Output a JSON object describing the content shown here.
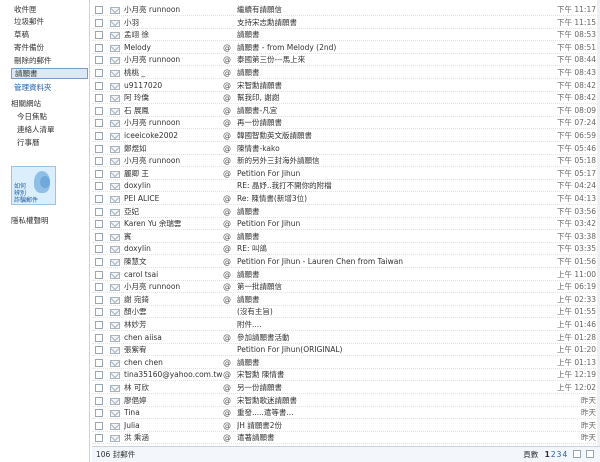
{
  "sidebar": {
    "folders": [
      {
        "label": "收件匣",
        "active": false,
        "link": false
      },
      {
        "label": "垃圾郵件",
        "active": false,
        "link": false
      },
      {
        "label": "草稿",
        "active": false,
        "link": false
      },
      {
        "label": "寄件備份",
        "active": false,
        "link": false
      },
      {
        "label": "刪除的郵件",
        "active": false,
        "link": false
      },
      {
        "label": "請願書",
        "active": true,
        "link": false
      },
      {
        "label": "管理資料夾",
        "active": false,
        "link": true
      }
    ],
    "section_label": "相關網站",
    "section_items": [
      "今日焦點",
      "連絡人清單",
      "行事曆"
    ],
    "promo_lines": [
      "如何",
      "辨別",
      "詐騙郵件"
    ],
    "privacy_label": "隱私權聲明"
  },
  "messages": [
    {
      "sender": "小月亮 runnoon",
      "attachment": "",
      "subject": "繼續有請願信",
      "time": "下午 11:17"
    },
    {
      "sender": "小羽",
      "attachment": "",
      "subject": "支持宋志勳請願書",
      "time": "下午 11:15"
    },
    {
      "sender": "孟翊 徐",
      "attachment": "",
      "subject": "請願書",
      "time": "下午 08:53"
    },
    {
      "sender": "Melody",
      "attachment": "@",
      "subject": "請願書 - from Melody (2nd)",
      "time": "下午 08:51"
    },
    {
      "sender": "小月亮 runnoon",
      "attachment": "@",
      "subject": "泰國第三份---馬上來",
      "time": "下午 08:44"
    },
    {
      "sender": "桃桃 _",
      "attachment": "@",
      "subject": "請願書",
      "time": "下午 08:43"
    },
    {
      "sender": "u9117020",
      "attachment": "@",
      "subject": "宋智勳請願書",
      "time": "下午 08:42"
    },
    {
      "sender": "阿 玲僑",
      "attachment": "@",
      "subject": "幫我印, 謝謝",
      "time": "下午 08:42"
    },
    {
      "sender": "石 展鳳",
      "attachment": "@",
      "subject": "請願書-凡宜",
      "time": "下午 08:09"
    },
    {
      "sender": "小月亮 runnoon",
      "attachment": "@",
      "subject": "再一份請願書",
      "time": "下午 07:24"
    },
    {
      "sender": "iceeicoke2002",
      "attachment": "@",
      "subject": "韓國智勳英文版請願書",
      "time": "下午 06:59"
    },
    {
      "sender": "鄭煜如",
      "attachment": "@",
      "subject": "陳情書-kako",
      "time": "下午 05:46"
    },
    {
      "sender": "小月亮 runnoon",
      "attachment": "@",
      "subject": "新的另外三封海外請願信",
      "time": "下午 05:18"
    },
    {
      "sender": "麗卿 王",
      "attachment": "@",
      "subject": "Petition For Jihun",
      "time": "下午 05:17"
    },
    {
      "sender": "doxylin",
      "attachment": "",
      "subject": "RE: 晶妤..我打不開你的附檔",
      "time": "下午 04:24"
    },
    {
      "sender": "PEI ALICE",
      "attachment": "@",
      "subject": "Re: 陳情書(新增3位)",
      "time": "下午 04:13"
    },
    {
      "sender": "亞妃",
      "attachment": "@",
      "subject": "請願書",
      "time": "下午 03:56"
    },
    {
      "sender": "Karen Yu 余瑞雲",
      "attachment": "@",
      "subject": "Petition For Jihun",
      "time": "下午 03:42"
    },
    {
      "sender": "賓",
      "attachment": "@",
      "subject": "請願書",
      "time": "下午 03:38"
    },
    {
      "sender": "doxylin",
      "attachment": "@",
      "subject": "RE: 叫鴿",
      "time": "下午 03:35"
    },
    {
      "sender": "陳慧文",
      "attachment": "@",
      "subject": "Petition For Jihun - Lauren Chen from Taiwan",
      "time": "下午 01:56"
    },
    {
      "sender": "carol tsai",
      "attachment": "@",
      "subject": "請願書",
      "time": "上午 11:00"
    },
    {
      "sender": "小月亮 runnoon",
      "attachment": "@",
      "subject": "第一批請願信",
      "time": "上午 06:19"
    },
    {
      "sender": "謝 宛錡",
      "attachment": "@",
      "subject": "請願書",
      "time": "上午 02:33"
    },
    {
      "sender": "顏小雲",
      "attachment": "",
      "subject": "(沒有主旨)",
      "time": "上午 01:55"
    },
    {
      "sender": "林妙芳",
      "attachment": "",
      "subject": "附件....",
      "time": "上午 01:46"
    },
    {
      "sender": "chen aiisa",
      "attachment": "@",
      "subject": "參加請願書活動",
      "time": "上午 01:28"
    },
    {
      "sender": "張紫宥",
      "attachment": "",
      "subject": "Petition For Jihun(ORIGINAL)",
      "time": "上午 01:20"
    },
    {
      "sender": "chen chen",
      "attachment": "@",
      "subject": "請願書",
      "time": "上午 01:13"
    },
    {
      "sender": "tina35160@yahoo.com.tw",
      "attachment": "@",
      "subject": "宋智勳 陳情書",
      "time": "上午 12:19"
    },
    {
      "sender": "林 可欣",
      "attachment": "@",
      "subject": "另一份請願書",
      "time": "上午 12:02"
    },
    {
      "sender": "廖俋婷",
      "attachment": "@",
      "subject": "宋智勳歌迷請願書",
      "time": "昨天"
    },
    {
      "sender": "Tina",
      "attachment": "@",
      "subject": "重發.....遣等書...",
      "time": "昨天"
    },
    {
      "sender": "Julia",
      "attachment": "@",
      "subject": "JH 請願書2份",
      "time": "昨天"
    },
    {
      "sender": "洪 乘涵",
      "attachment": "@",
      "subject": "遣著請願書",
      "time": "昨天"
    }
  ],
  "footer": {
    "count": "106 封郵件",
    "page_label": "頁數",
    "pages": [
      "1",
      "2",
      "3",
      "4"
    ],
    "current_page": "1"
  }
}
